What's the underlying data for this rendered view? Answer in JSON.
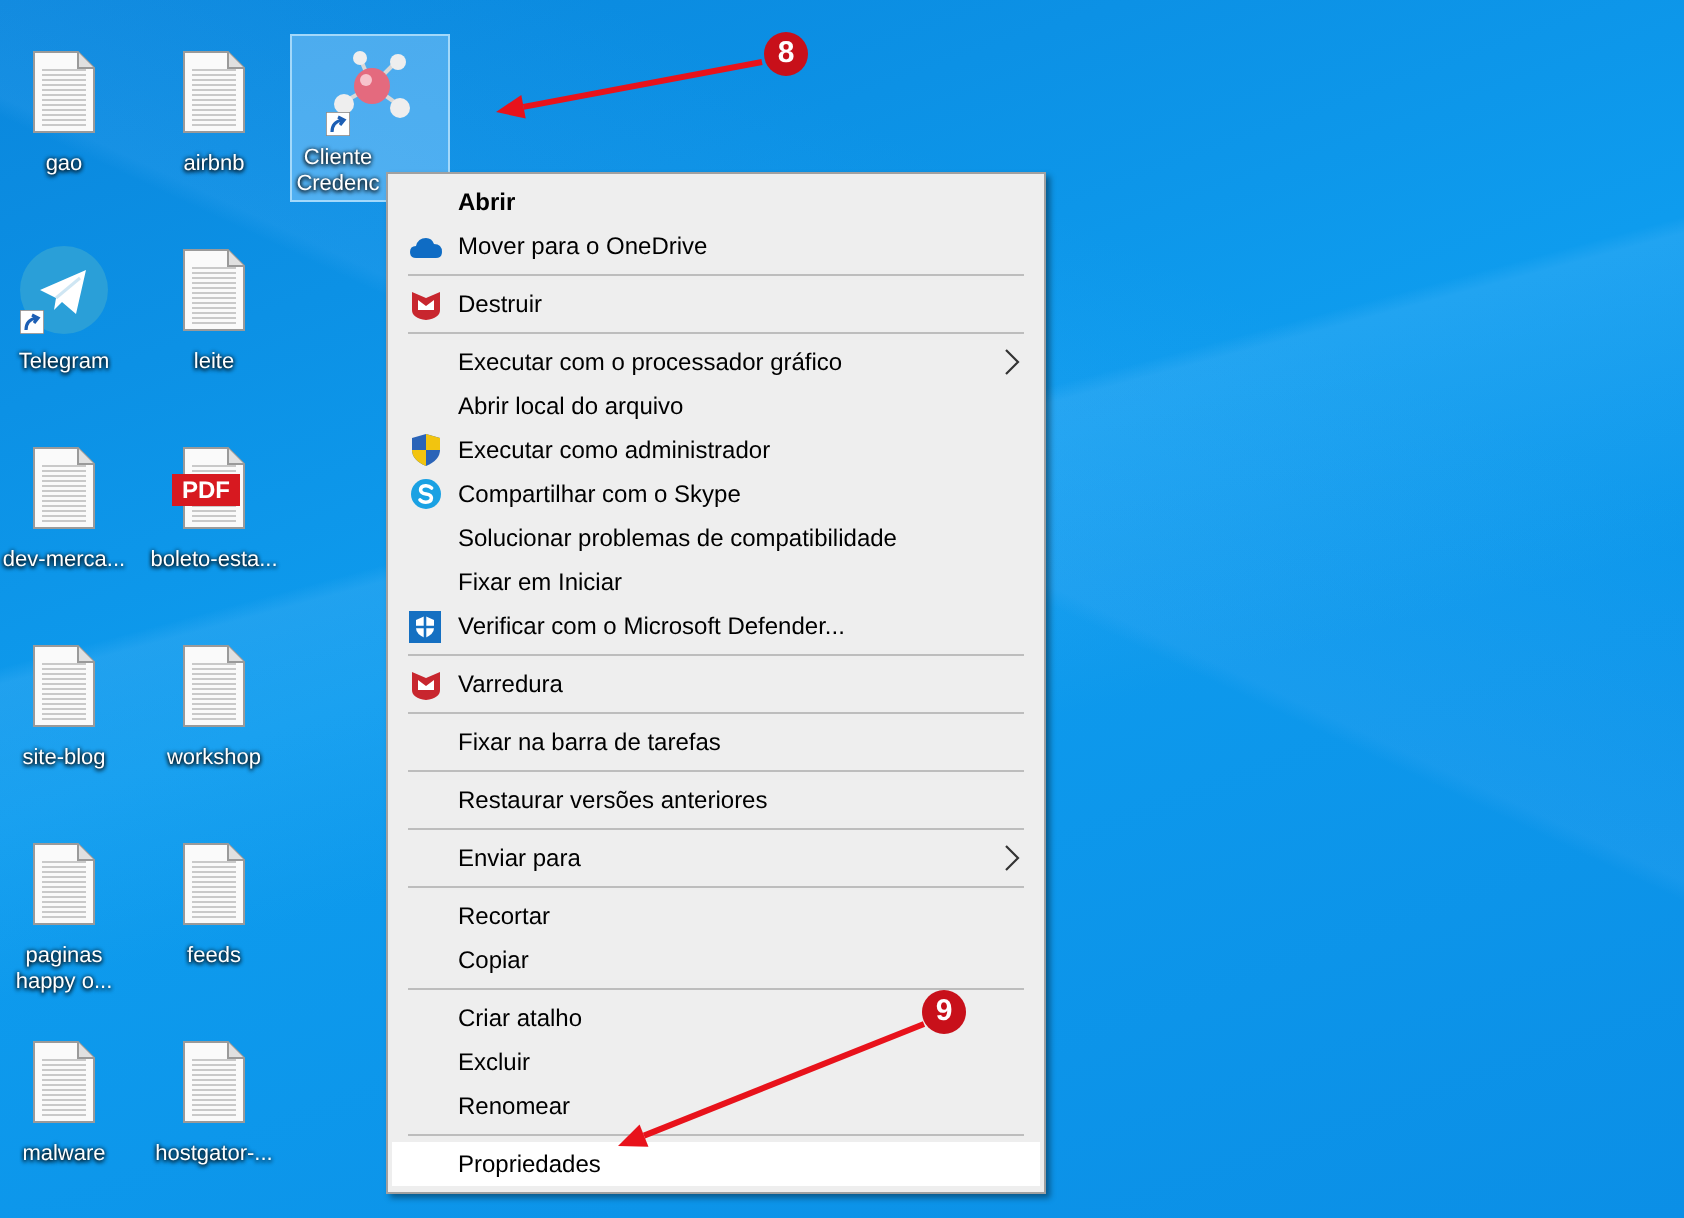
{
  "desktop_icons": [
    {
      "label": "gao",
      "kind": "document",
      "selected": false,
      "shortcut": false
    },
    {
      "label": "Telegram",
      "kind": "telegram",
      "selected": false,
      "shortcut": true
    },
    {
      "label": "dev-merca...",
      "kind": "document",
      "selected": false,
      "shortcut": false
    },
    {
      "label": "site-blog",
      "kind": "document",
      "selected": false,
      "shortcut": false
    },
    {
      "label": "paginas happy o...",
      "kind": "document",
      "selected": false,
      "shortcut": false
    },
    {
      "label": "malware",
      "kind": "document",
      "selected": false,
      "shortcut": false
    },
    {
      "label": "airbnb",
      "kind": "document",
      "selected": false,
      "shortcut": false
    },
    {
      "label": "leite",
      "kind": "document",
      "selected": false,
      "shortcut": false
    },
    {
      "label": "boleto-esta...",
      "kind": "pdf",
      "selected": false,
      "shortcut": false,
      "badge": "PDF"
    },
    {
      "label": "workshop",
      "kind": "document",
      "selected": false,
      "shortcut": false
    },
    {
      "label": "feeds",
      "kind": "document",
      "selected": false,
      "shortcut": false
    },
    {
      "label": "hostgator-...",
      "kind": "document",
      "selected": false,
      "shortcut": false
    },
    {
      "label": "Cliente Credenc",
      "kind": "app",
      "selected": true,
      "shortcut": true
    }
  ],
  "context_menu": {
    "items": [
      {
        "kind": "plain",
        "label": "Abrir",
        "bold": true,
        "submenu": false,
        "selected": false
      },
      {
        "kind": "cloud",
        "label": "Mover para o OneDrive",
        "bold": false,
        "submenu": false,
        "selected": false
      },
      {
        "kind": "separator"
      },
      {
        "kind": "mcafee",
        "label": "Destruir",
        "bold": false,
        "submenu": false,
        "selected": false
      },
      {
        "kind": "separator"
      },
      {
        "kind": "plain",
        "label": "Executar com o processador gráfico",
        "bold": false,
        "submenu": true,
        "selected": false
      },
      {
        "kind": "plain",
        "label": "Abrir local do arquivo",
        "bold": false,
        "submenu": false,
        "selected": false
      },
      {
        "kind": "uac",
        "label": "Executar como administrador",
        "bold": false,
        "submenu": false,
        "selected": false
      },
      {
        "kind": "skype",
        "label": "Compartilhar com o Skype",
        "bold": false,
        "submenu": false,
        "selected": false
      },
      {
        "kind": "plain",
        "label": "Solucionar problemas de compatibilidade",
        "bold": false,
        "submenu": false,
        "selected": false
      },
      {
        "kind": "plain",
        "label": "Fixar em Iniciar",
        "bold": false,
        "submenu": false,
        "selected": false
      },
      {
        "kind": "defender",
        "label": "Verificar com o Microsoft Defender...",
        "bold": false,
        "submenu": false,
        "selected": false
      },
      {
        "kind": "separator"
      },
      {
        "kind": "mcafee",
        "label": "Varredura",
        "bold": false,
        "submenu": false,
        "selected": false
      },
      {
        "kind": "separator"
      },
      {
        "kind": "plain",
        "label": "Fixar na barra de tarefas",
        "bold": false,
        "submenu": false,
        "selected": false
      },
      {
        "kind": "separator"
      },
      {
        "kind": "plain",
        "label": "Restaurar versões anteriores",
        "bold": false,
        "submenu": false,
        "selected": false
      },
      {
        "kind": "separator"
      },
      {
        "kind": "plain",
        "label": "Enviar para",
        "bold": false,
        "submenu": true,
        "selected": false
      },
      {
        "kind": "separator"
      },
      {
        "kind": "plain",
        "label": "Recortar",
        "bold": false,
        "submenu": false,
        "selected": false
      },
      {
        "kind": "plain",
        "label": "Copiar",
        "bold": false,
        "submenu": false,
        "selected": false
      },
      {
        "kind": "separator"
      },
      {
        "kind": "plain",
        "label": "Criar atalho",
        "bold": false,
        "submenu": false,
        "selected": false
      },
      {
        "kind": "plain",
        "label": "Excluir",
        "bold": false,
        "submenu": false,
        "selected": false
      },
      {
        "kind": "plain",
        "label": "Renomear",
        "bold": false,
        "submenu": false,
        "selected": false
      },
      {
        "kind": "separator"
      },
      {
        "kind": "plain",
        "label": "Propriedades",
        "bold": false,
        "submenu": false,
        "selected": true
      }
    ]
  },
  "annotations": [
    {
      "number": "8"
    },
    {
      "number": "9"
    }
  ]
}
